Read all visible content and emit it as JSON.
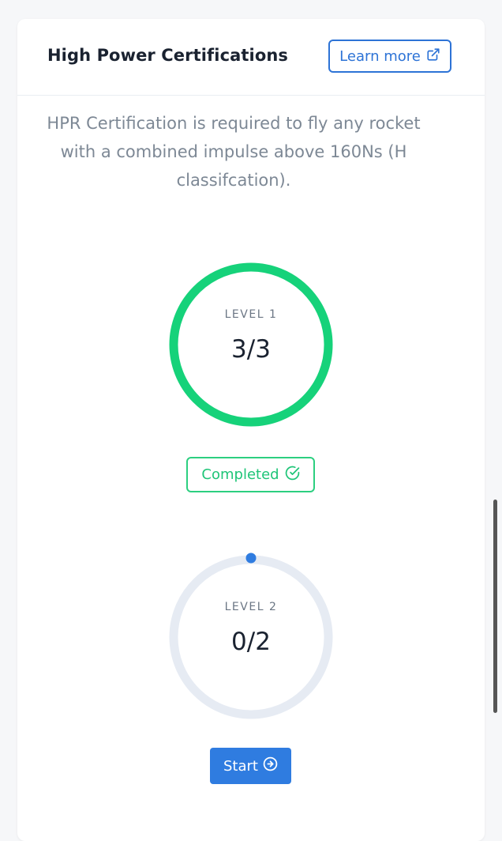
{
  "header": {
    "title": "High Power Certifications",
    "learn_more_label": "Learn more",
    "learn_more_icon": "external-link-icon"
  },
  "description": "HPR Certification is required to fly any rocket with a combined impulse above 160Ns (H classifcation).",
  "levels": [
    {
      "label": "LEVEL 1",
      "count": "3/3",
      "progress": 1.0,
      "status": "completed",
      "status_label": "Completed",
      "status_icon": "check-circle-icon",
      "ring_color": "#16d27a"
    },
    {
      "label": "LEVEL 2",
      "count": "0/2",
      "progress": 0.0,
      "status": "not-started",
      "action_label": "Start",
      "action_icon": "arrow-right-circle-icon",
      "ring_color": "#e6ebf3",
      "indicator_color": "#2f7ce0"
    }
  ],
  "colors": {
    "accent_blue": "#2d73d6",
    "success_green": "#1fc578",
    "track_gray": "#e6ebf3"
  }
}
